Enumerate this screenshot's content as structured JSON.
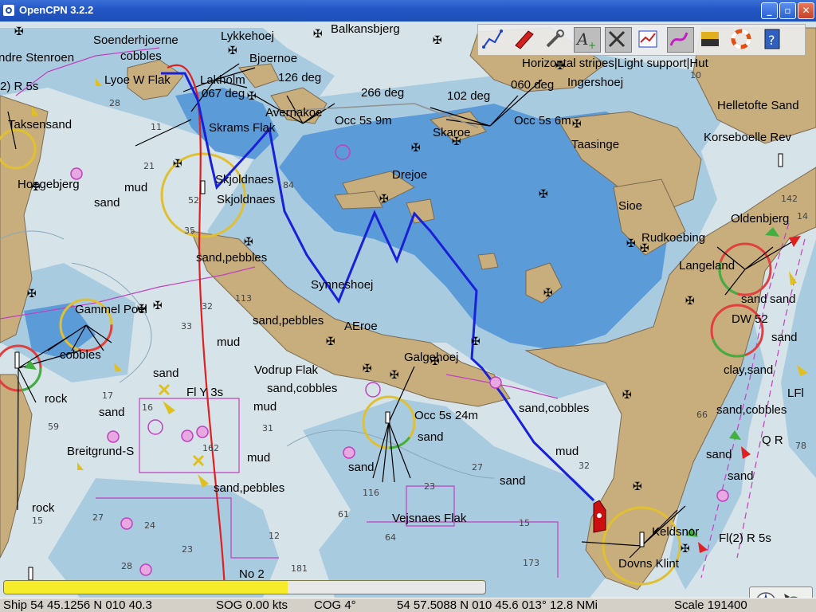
{
  "window": {
    "title": "OpenCPN 3.2.2"
  },
  "toolbar": {
    "buttons": [
      {
        "icon": "route-icon",
        "label": "Route"
      },
      {
        "icon": "boat-icon",
        "label": "Own ship"
      },
      {
        "icon": "tools-icon",
        "label": "Tools"
      },
      {
        "icon": "text-plus-icon",
        "label": "Text"
      },
      {
        "icon": "x-tool-icon",
        "label": "Clear"
      },
      {
        "icon": "chart-stats-icon",
        "label": "Stats"
      },
      {
        "icon": "track-icon",
        "label": "Track"
      },
      {
        "icon": "color-scheme-icon",
        "label": "Colors"
      },
      {
        "icon": "lifebuoy-icon",
        "label": "MOB"
      },
      {
        "icon": "help-icon",
        "label": "?"
      }
    ]
  },
  "labels": {
    "soenderhjoerne": "Soenderhjoerne",
    "cobbles1": "cobbles",
    "lykkehoej": "Lykkehoej",
    "balkansbjerg": "Balkansbjerg",
    "andre_stenroen": "ndre Stenroen",
    "bjoernoe": "Bjoernoe",
    "deg126": "126 deg",
    "lyoe": "Lyoe W Flak",
    "lakholm": "Lakholm",
    "deg067": "067 deg",
    "deg266": "266 deg",
    "deg102": "102 deg",
    "deg060": "060 deg",
    "ingershoej": "Ingershoej",
    "avernakoe": "Avernakoe",
    "occ5s9m": "Occ 5s 9m",
    "occ5s6m": "Occ 5s 6m",
    "fl2r5s_left": "2) R 5s",
    "taksensand": "Taksensand",
    "skrams_flak": "Skrams Flak",
    "skaroe": "Skaroe",
    "taasinge": "Taasinge",
    "helletofte": "Helletofte Sand",
    "korseboelle": "Korseboelle Rev",
    "hoegebjerg": "Hoegebjerg",
    "mud1": "mud",
    "sand1": "sand",
    "skjoldnaes1": "Skjoldnaes",
    "skjoldnaes2": "Skjoldnaes",
    "drejoe": "Drejoe",
    "sioe": "Sioe",
    "oldenbjerg": "Oldenbjerg",
    "rudkoebing": "Rudkoebing",
    "langeland": "Langeland",
    "sand_pebbles1": "sand,pebbles",
    "synneshoej": "Synneshoej",
    "gammel_poel": "Gammel Poel",
    "sand_pebbles2": "sand,pebbles",
    "aeroe": "AEroe",
    "sand_dw": "sand",
    "dw52": "DW 52",
    "mud2": "mud",
    "cobbles2": "cobbles",
    "galgehoej": "Galgehoej",
    "sand_r": "sand",
    "vodrup": "Vodrup Flak",
    "sand_cobbles1": "sand,cobbles",
    "clay_sand": "clay,sand",
    "sand2": "sand",
    "fly3s": "Fl Y 3s",
    "rock1": "rock",
    "lfl": "LFl",
    "sand3": "sand",
    "mud3": "mud",
    "occ5s24m": "Occ 5s 24m",
    "sand_cobbles2": "sand,cobbles",
    "sand_cobbles3": "sand,cobbles",
    "sand4": "sand",
    "qr": "Q R",
    "breitgrund": "Breitgrund-S",
    "mud4": "mud",
    "mud5": "mud",
    "sand5": "sand",
    "sand6": "sand",
    "sand7": "sand",
    "sand_pebbles3": "sand,pebbles",
    "sand8": "sand",
    "rock2": "rock",
    "vejsnaes": "Vejsnaes Flak",
    "sand9": "sand",
    "keldsnor": "Keldsnor",
    "fl2r5s_right": "Fl(2) R 5s",
    "dovns_klint": "Dovns Klint",
    "no2": "No 2",
    "light_support": "Horizontal stripes|Light support|Hut"
  },
  "progress": {
    "fraction": 0.59
  },
  "status": {
    "ship": "Ship 54 45.1256 N   010 40.3",
    "sog": "SOG 0.00 kts",
    "cog": "COG  4°",
    "cursor": "54 57.5088 N   010 45.6  013°  12.8 NMi",
    "scale": "Scale 191400"
  },
  "colors": {
    "deep_water": "#d6e4ea",
    "medium_water": "#a9cbe0",
    "shallow_water": "#5b9bd8",
    "land": "#c8ae7c",
    "track_red": "#e02020",
    "route_blue": "#1a20d8",
    "progress_fill": "#f7ec2a"
  }
}
